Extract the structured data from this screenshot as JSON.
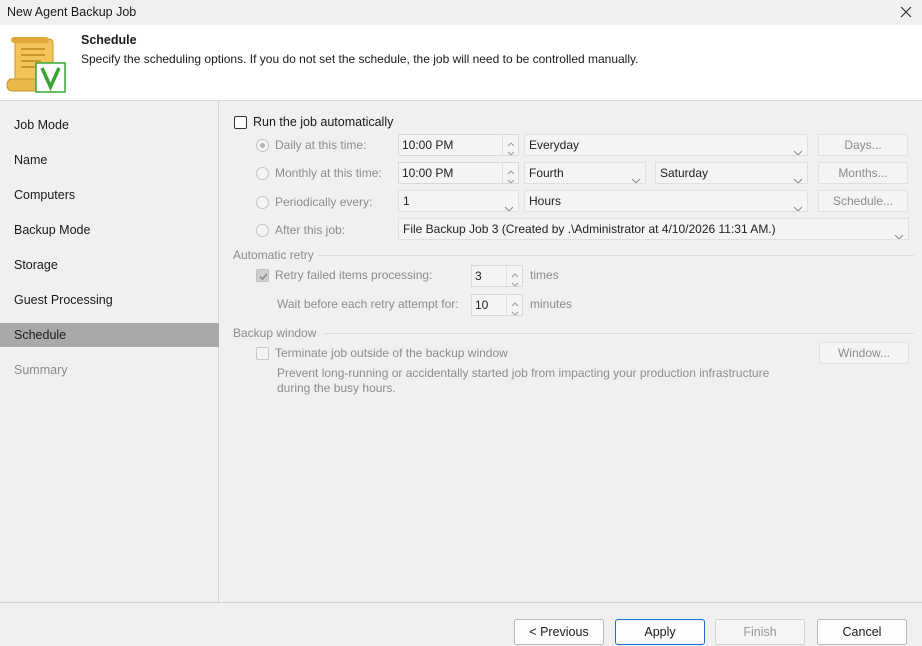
{
  "window": {
    "title": "New Agent Backup Job"
  },
  "header": {
    "title": "Schedule",
    "description": "Specify the scheduling options. If you do not set the schedule, the job will need to be controlled manually."
  },
  "sidebar": {
    "items": [
      {
        "label": "Job Mode",
        "state": "normal"
      },
      {
        "label": "Name",
        "state": "normal"
      },
      {
        "label": "Computers",
        "state": "normal"
      },
      {
        "label": "Backup Mode",
        "state": "normal"
      },
      {
        "label": "Storage",
        "state": "normal"
      },
      {
        "label": "Guest Processing",
        "state": "normal"
      },
      {
        "label": "Schedule",
        "state": "active"
      },
      {
        "label": "Summary",
        "state": "disabled"
      }
    ]
  },
  "schedule": {
    "run_automatically": {
      "label": "Run the job automatically",
      "checked": false
    },
    "daily": {
      "label": "Daily at this time:",
      "time": "10:00 PM",
      "frequency": "Everyday",
      "button": "Days...",
      "selected": true
    },
    "monthly": {
      "label": "Monthly at this time:",
      "time": "10:00 PM",
      "week": "Fourth",
      "day": "Saturday",
      "button": "Months..."
    },
    "periodically": {
      "label": "Periodically every:",
      "value": "1",
      "unit": "Hours",
      "button": "Schedule..."
    },
    "after_job": {
      "label": "After this job:",
      "value": "File Backup Job 3 (Created by .\\Administrator at 4/10/2026 11:31 AM.)"
    }
  },
  "automatic_retry": {
    "title": "Automatic retry",
    "retry_label": "Retry failed items processing:",
    "retry_value": "3",
    "retry_unit": "times",
    "retry_checked": true,
    "wait_label": "Wait before each retry attempt for:",
    "wait_value": "10",
    "wait_unit": "minutes"
  },
  "backup_window": {
    "title": "Backup window",
    "terminate_label": "Terminate job outside of the backup window",
    "terminate_checked": false,
    "description_line1": "Prevent long-running or accidentally started job from impacting your production infrastructure",
    "description_line2": "during the busy hours.",
    "button": "Window..."
  },
  "footer": {
    "previous": "< Previous",
    "apply": "Apply",
    "finish": "Finish",
    "cancel": "Cancel"
  },
  "colors": {
    "active_nav": "#a9a9a9",
    "primary_border": "#1e6fcf",
    "icon_green": "#3aa335",
    "icon_gold": "#e8b84a"
  }
}
